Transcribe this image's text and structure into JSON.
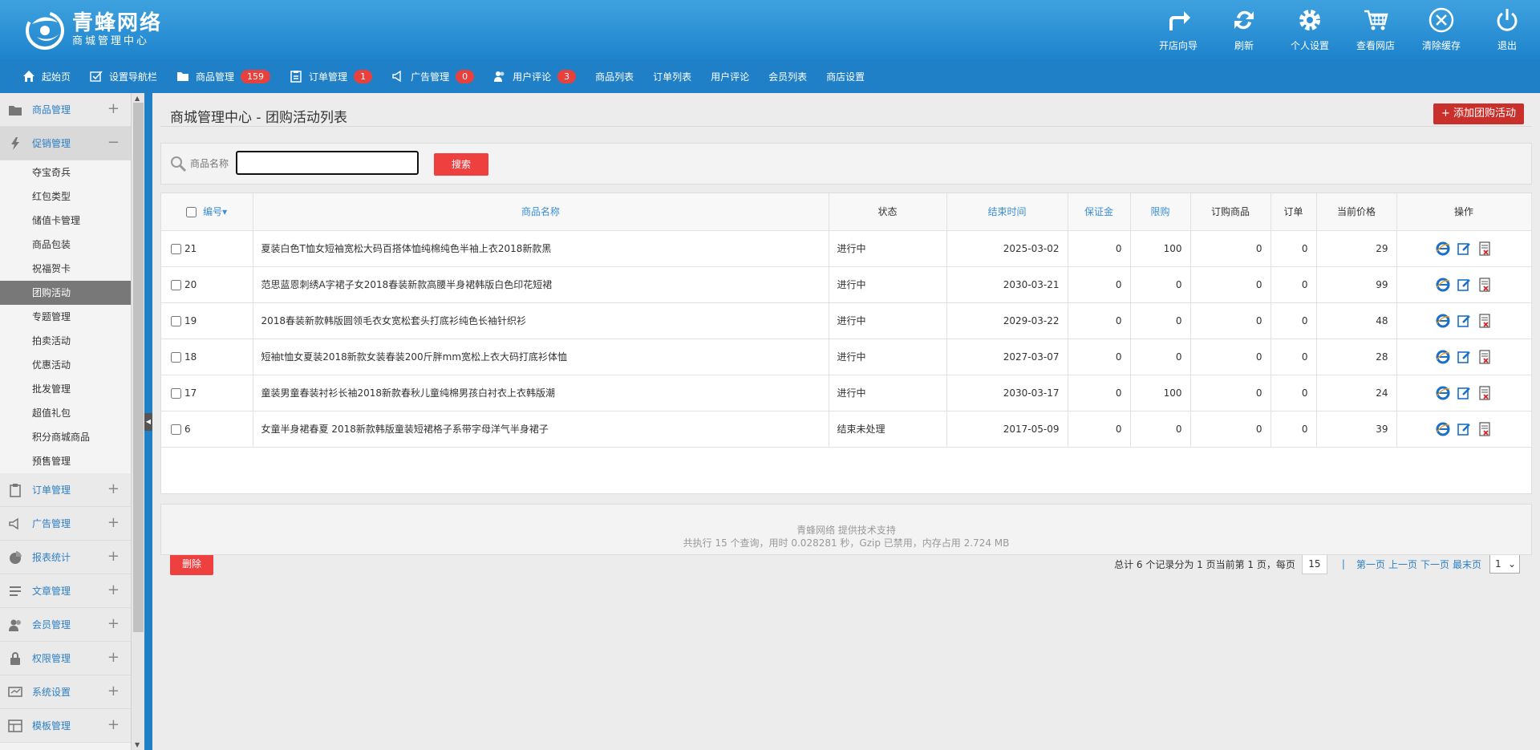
{
  "brand": {
    "title": "青蜂网络",
    "subtitle": "商城管理中心"
  },
  "top_tools": [
    {
      "label": "开店向导",
      "icon": "share-arrow-icon"
    },
    {
      "label": "刷新",
      "icon": "refresh-icon"
    },
    {
      "label": "个人设置",
      "icon": "gear-icon"
    },
    {
      "label": "查看网店",
      "icon": "cart-icon"
    },
    {
      "label": "清除缓存",
      "icon": "close-circle-icon"
    },
    {
      "label": "退出",
      "icon": "power-icon"
    }
  ],
  "nav": [
    {
      "label": "起始页",
      "icon": "home-icon"
    },
    {
      "label": "设置导航栏",
      "icon": "checkbox-icon"
    },
    {
      "label": "商品管理",
      "icon": "folder-icon",
      "badge": "159"
    },
    {
      "label": "订单管理",
      "icon": "clipboard-icon",
      "badge": "1"
    },
    {
      "label": "广告管理",
      "icon": "megaphone-icon",
      "badge": "0"
    },
    {
      "label": "用户评论",
      "icon": "users-icon",
      "badge": "3"
    },
    {
      "label": "商品列表"
    },
    {
      "label": "订单列表"
    },
    {
      "label": "用户评论"
    },
    {
      "label": "会员列表"
    },
    {
      "label": "商店设置"
    }
  ],
  "sidebar": {
    "groups_top": [
      {
        "label": "商品管理",
        "icon": "folder-icon",
        "toggle": "+"
      },
      {
        "label": "促销管理",
        "icon": "lightning-icon",
        "toggle": "−"
      }
    ],
    "sub_items": [
      "夺宝奇兵",
      "红包类型",
      "储值卡管理",
      "商品包装",
      "祝福贺卡",
      "团购活动",
      "专题管理",
      "拍卖活动",
      "优惠活动",
      "批发管理",
      "超值礼包",
      "积分商城商品",
      "预售管理"
    ],
    "groups_bottom": [
      {
        "label": "订单管理",
        "icon": "clipboard-icon",
        "toggle": "+"
      },
      {
        "label": "广告管理",
        "icon": "megaphone-icon",
        "toggle": "+"
      },
      {
        "label": "报表统计",
        "icon": "pie-chart-icon",
        "toggle": "+"
      },
      {
        "label": "文章管理",
        "icon": "list-icon",
        "toggle": "+"
      },
      {
        "label": "会员管理",
        "icon": "users-icon",
        "toggle": "+"
      },
      {
        "label": "权限管理",
        "icon": "lock-icon",
        "toggle": "+"
      },
      {
        "label": "系统设置",
        "icon": "monitor-icon",
        "toggle": "+"
      },
      {
        "label": "模板管理",
        "icon": "template-icon",
        "toggle": "+"
      }
    ]
  },
  "page": {
    "title": "商城管理中心 - 团购活动列表",
    "add_button": "添加团购活动"
  },
  "search": {
    "label": "商品名称",
    "value": "",
    "button": "搜索"
  },
  "table": {
    "headers": [
      "编号",
      "商品名称",
      "状态",
      "结束时间",
      "保证金",
      "限购",
      "订购商品",
      "订单",
      "当前价格",
      "操作"
    ],
    "rows": [
      {
        "id": "21",
        "name": "夏装白色T恤女短袖宽松大码百搭体恤纯棉纯色半袖上衣2018新款黑",
        "status": "进行中",
        "end": "2025-03-02",
        "deposit": "0",
        "limit": "100",
        "ordered": "0",
        "orders": "0",
        "price": "29"
      },
      {
        "id": "20",
        "name": "范思蓝恩刺绣A字裙子女2018春装新款高腰半身裙韩版白色印花短裙",
        "status": "进行中",
        "end": "2030-03-21",
        "deposit": "0",
        "limit": "0",
        "ordered": "0",
        "orders": "0",
        "price": "99"
      },
      {
        "id": "19",
        "name": "2018春装新款韩版圆领毛衣女宽松套头打底衫纯色长袖针织衫",
        "status": "进行中",
        "end": "2029-03-22",
        "deposit": "0",
        "limit": "0",
        "ordered": "0",
        "orders": "0",
        "price": "48"
      },
      {
        "id": "18",
        "name": "短袖t恤女夏装2018新款女装春装200斤胖mm宽松上衣大码打底衫体恤",
        "status": "进行中",
        "end": "2027-03-07",
        "deposit": "0",
        "limit": "0",
        "ordered": "0",
        "orders": "0",
        "price": "28"
      },
      {
        "id": "17",
        "name": "童装男童春装衬衫长袖2018新款春秋儿童纯棉男孩白衬衣上衣韩版潮",
        "status": "进行中",
        "end": "2030-03-17",
        "deposit": "0",
        "limit": "100",
        "ordered": "0",
        "orders": "0",
        "price": "24"
      },
      {
        "id": "6",
        "name": "女童半身裙春夏 2018新款韩版童装短裙格子系带字母洋气半身裙子",
        "status": "结束未处理",
        "end": "2017-05-09",
        "deposit": "0",
        "limit": "0",
        "ordered": "0",
        "orders": "0",
        "price": "39"
      }
    ]
  },
  "bottom": {
    "delete_button": "删除",
    "pager_text": "总计 6 个记录分为 1 页当前第 1 页，每页",
    "per_page": "15",
    "separator": "|",
    "first": "第一页",
    "prev": "上一页",
    "next": "下一页",
    "last": "最末页",
    "page_select": "1"
  },
  "footer": {
    "line1": "青蜂网络 提供技术支持",
    "line2": "共执行 15 个查询，用时 0.028281 秒，Gzip 已禁用，内存占用 2.724 MB"
  },
  "colors": {
    "header_blue": "#1f80c8",
    "accent_red": "#ef4040",
    "link_blue": "#2e7fc2",
    "active_gray": "#787878"
  }
}
